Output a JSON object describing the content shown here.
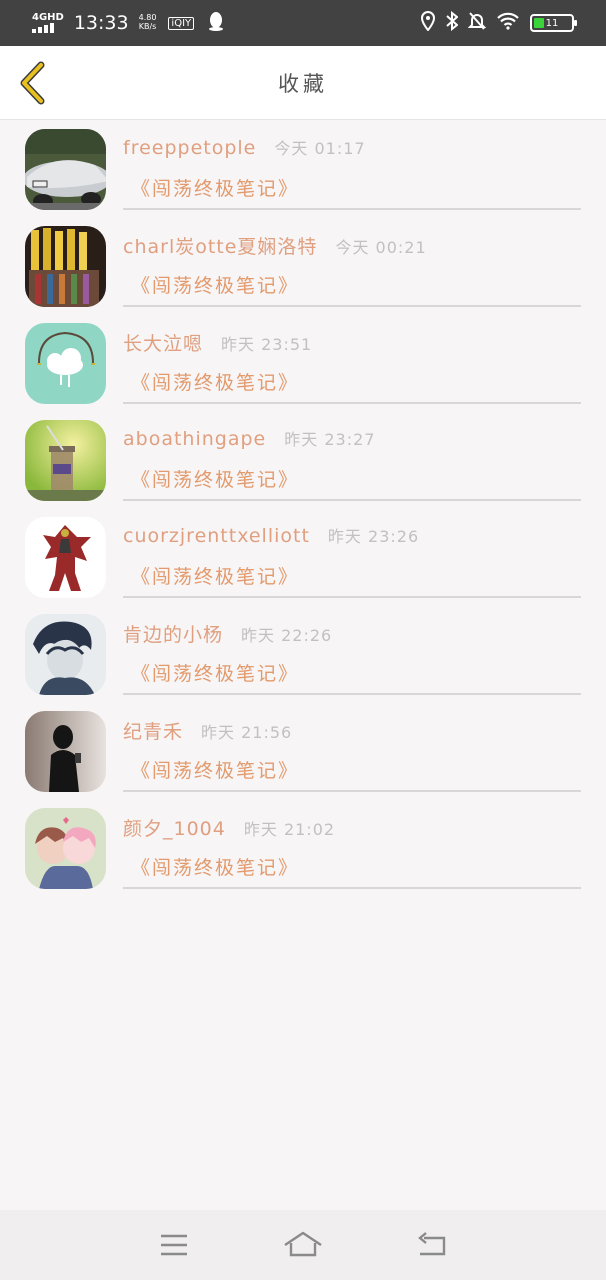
{
  "status_bar": {
    "network": "4GHD",
    "time": "13:33",
    "speed_value": "4.80",
    "speed_unit": "KB/s",
    "app_badge": "iQIY",
    "battery_level": "11",
    "colors": {
      "background": "#424242",
      "battery_fill": "#3ad43a"
    }
  },
  "header": {
    "title": "收藏",
    "back_icon": "chevron-left-icon",
    "accent_color": "#e8c020"
  },
  "items": [
    {
      "username": "freeppetople",
      "time": "今天 01:17",
      "title": "《闯荡终极笔记》",
      "avatar": "silver sports car"
    },
    {
      "username": "charl炭otte夏娴洛特",
      "time": "今天 00:21",
      "title": "《闯荡终极笔记》",
      "avatar": "colorful pencils"
    },
    {
      "username": "长大泣嗯",
      "time": "昨天 23:51",
      "title": "《闯荡终极笔记》",
      "avatar": "cloud swing illustration"
    },
    {
      "username": "aboathingape",
      "time": "昨天 23:27",
      "title": "《闯荡终极笔记》",
      "avatar": "drink jar"
    },
    {
      "username": "cuorzjrenttxelliott",
      "time": "昨天 23:26",
      "title": "《闯荡终极笔记》",
      "avatar": "red robot"
    },
    {
      "username": "肯边的小杨",
      "time": "昨天 22:26",
      "title": "《闯荡终极笔记》",
      "avatar": "anime boy sketch"
    },
    {
      "username": "纪青禾",
      "time": "昨天 21:56",
      "title": "《闯荡终极笔记》",
      "avatar": "silhouette girl"
    },
    {
      "username": "颜夕_1004",
      "time": "昨天 21:02",
      "title": "《闯荡终极笔记》",
      "avatar": "anime couple"
    }
  ],
  "bottom_nav": {
    "menu_icon": "menu-icon",
    "home_icon": "home-icon",
    "back_icon": "return-icon"
  },
  "colors": {
    "username": "#e0a080",
    "title": "#e39a6c",
    "time": "#c2c0c0"
  }
}
